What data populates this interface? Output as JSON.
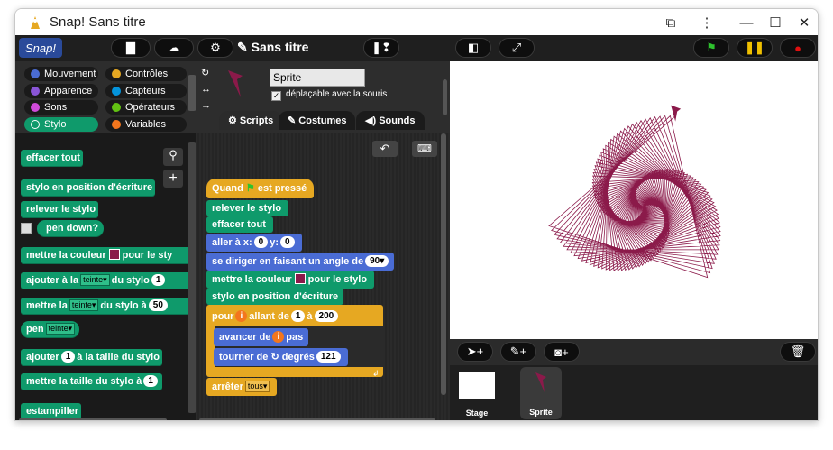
{
  "window": {
    "title": "Snap! Sans titre"
  },
  "topbar": {
    "project_title": "Sans titre",
    "logo_text": "Snap!"
  },
  "categories": [
    {
      "label": "Mouvement",
      "color": "#4a6cd4"
    },
    {
      "label": "Contrôles",
      "color": "#e6a822"
    },
    {
      "label": "Apparence",
      "color": "#8a55d7"
    },
    {
      "label": "Capteurs",
      "color": "#0494dc"
    },
    {
      "label": "Sons",
      "color": "#cf4ad9"
    },
    {
      "label": "Opérateurs",
      "color": "#62c213"
    },
    {
      "label": "Stylo",
      "color": "#0f9a6b"
    },
    {
      "label": "Variables",
      "color": "#f3761d"
    }
  ],
  "palette_blocks": {
    "clear": "effacer tout",
    "pen_down": "stylo en position d'écriture",
    "pen_up": "relever le stylo",
    "pen_down_q": "pen down?",
    "set_color_a": "mettre la couleur",
    "set_color_b": "pour le sty",
    "change_by_a": "ajouter à la",
    "change_by_dd": "teinte",
    "change_by_b": "du stylo",
    "change_by_val": "1",
    "set_to_a": "mettre la",
    "set_to_dd": "teinte",
    "set_to_b": "du stylo à",
    "set_to_val": "50",
    "pen_a": "pen",
    "pen_dd": "teinte",
    "size_change_a": "ajouter",
    "size_change_val": "1",
    "size_change_b": "à la taille du stylo",
    "size_set_a": "mettre la taille du stylo à",
    "size_set_val": "1",
    "stamp": "estampiller"
  },
  "sprite": {
    "name": "Sprite",
    "draggable_label": "déplaçable avec la souris",
    "draggable_check": "✓"
  },
  "tabs": {
    "scripts": "Scripts",
    "costumes": "Costumes",
    "sounds": "Sounds"
  },
  "script": {
    "hat_a": "Quand",
    "hat_b": "est pressé",
    "pen_up": "relever le stylo",
    "clear": "effacer tout",
    "goto_a": "aller à x:",
    "goto_x": "0",
    "goto_y_label": "y:",
    "goto_y": "0",
    "heading_a": "se diriger en faisant un angle de",
    "heading_val": "90",
    "color_a": "mettre la couleur",
    "color_b": "pour le stylo",
    "pen_down": "stylo en position d'écriture",
    "for_a": "pour",
    "for_var": "i",
    "for_b": "allant de",
    "for_from": "1",
    "for_c": "à",
    "for_to": "200",
    "move_a": "avancer de",
    "move_var": "i",
    "move_b": "pas",
    "turn_a": "tourner de",
    "turn_b": "degrés",
    "turn_val": "121",
    "stop_a": "arrêter",
    "stop_dd": "tous"
  },
  "corral": {
    "stage_label": "Stage",
    "sprite_label": "Sprite"
  },
  "colors": {
    "pen": "#8b1a4a",
    "pen_category": "#0f9a6b",
    "motion": "#4a6cd4",
    "control": "#e6a822"
  }
}
